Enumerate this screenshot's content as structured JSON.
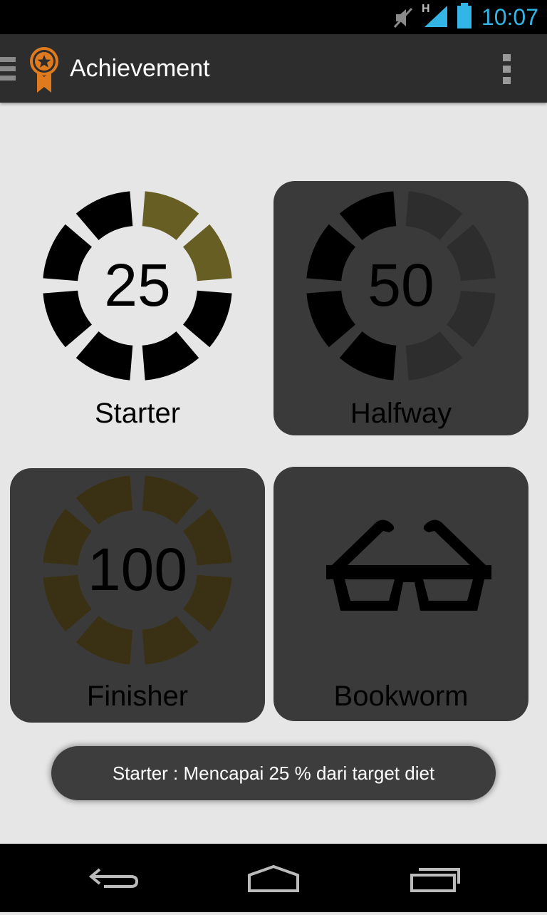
{
  "status_bar": {
    "time": "10:07",
    "network_type": "H",
    "icons": [
      "muted-icon",
      "signal-icon",
      "battery-icon"
    ],
    "accent_color": "#33b5e5"
  },
  "action_bar": {
    "title": "Achievement",
    "app_icon": "award-badge-icon",
    "menu_icon": "overflow-menu-icon"
  },
  "achievements": [
    {
      "label": "Starter",
      "number": "25",
      "icon": "progress-ring-icon",
      "selected": true,
      "fill_color": "#675e23"
    },
    {
      "label": "Halfway",
      "number": "50",
      "icon": "progress-ring-icon",
      "selected": false,
      "fill_color": "#000000"
    },
    {
      "label": "Finisher",
      "number": "100",
      "icon": "progress-ring-icon",
      "selected": false,
      "fill_color": "#3a3114"
    },
    {
      "label": "Bookworm",
      "number": "",
      "icon": "glasses-icon",
      "selected": false,
      "fill_color": "#000000"
    }
  ],
  "toast": {
    "text": "Starter : Mencapai 25 % dari target diet"
  },
  "nav_bar": {
    "back_icon": "back-icon",
    "home_icon": "home-icon",
    "recents_icon": "recents-icon"
  }
}
